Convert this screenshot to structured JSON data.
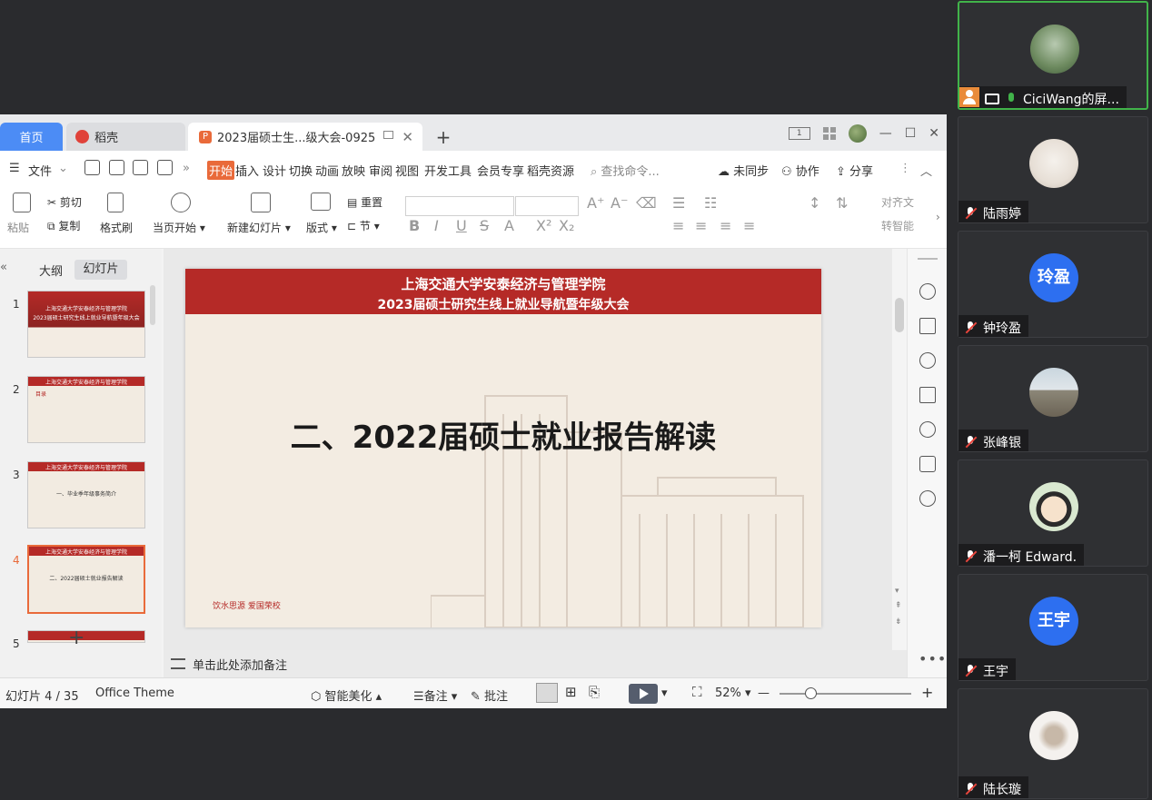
{
  "tabs": {
    "home": "首页",
    "docer": "稻壳",
    "document": "2023届硕士生...级大会-0925"
  },
  "window": {
    "view_badge": "1"
  },
  "menu": {
    "file": "文件",
    "items": [
      "开始",
      "插入",
      "设计",
      "切换",
      "动画",
      "放映",
      "审阅",
      "视图",
      "开发工具",
      "会员专享",
      "稻壳资源"
    ],
    "search_placeholder": "查找命令...",
    "sync": "未同步",
    "collab": "协作",
    "share": "分享"
  },
  "ribbon": {
    "paste": "粘贴",
    "cut": "剪切",
    "copy": "复制",
    "format_painter": "格式刷",
    "play_from_current": "当页开始",
    "new_slide": "新建幻灯片",
    "layout": "版式",
    "reset": "重置",
    "section": "节",
    "align_text": "对齐文",
    "convert_smartart": "转智能"
  },
  "left_panel": {
    "outline_tab": "大纲",
    "slides_tab": "幻灯片",
    "thumbnails": [
      {
        "num": "1",
        "line1": "上海交通大学安泰经济与管理学院",
        "line2": "2023届硕士研究生线上就业导航暨年级大会"
      },
      {
        "num": "2",
        "line1": "上海交通大学安泰经济与管理学院",
        "line2": "目录"
      },
      {
        "num": "3",
        "line1": "上海交通大学安泰经济与管理学院",
        "line2": "一、毕业季年级事务简介"
      },
      {
        "num": "4",
        "line1": "上海交通大学安泰经济与管理学院",
        "line2": "二、2022届硕士就业报告解读"
      },
      {
        "num": "5",
        "line1": "",
        "line2": ""
      }
    ]
  },
  "slide": {
    "header_line1": "上海交通大学安泰经济与管理学院",
    "header_line2": "2023届硕士研究生线上就业导航暨年级大会",
    "title": "二、2022届硕士就业报告解读",
    "footer": "饮水思源 爱国荣校"
  },
  "notes": {
    "placeholder": "单击此处添加备注"
  },
  "status": {
    "slide_counter": "幻灯片 4 / 35",
    "theme": "Office Theme",
    "beautify": "智能美化",
    "notes": "备注",
    "comments": "批注",
    "zoom": "52%"
  },
  "participants": [
    {
      "name": "CiciWang的屏...",
      "type": "photo",
      "sharing": true,
      "mic": "on"
    },
    {
      "name": "陆雨婷",
      "type": "photo",
      "mic": "off"
    },
    {
      "name": "钟玲盈",
      "type": "initials",
      "initials": "玲盈",
      "mic": "off"
    },
    {
      "name": "张峰银",
      "type": "photo",
      "mic": "off"
    },
    {
      "name": "潘一柯 Edward.",
      "type": "photo",
      "mic": "off"
    },
    {
      "name": "王宇",
      "type": "initials",
      "initials": "王宇",
      "mic": "off"
    },
    {
      "name": "陆长璇",
      "type": "photo",
      "mic": "off"
    }
  ],
  "colors": {
    "active_tile_border": "#41b34a",
    "slide_band": "#b52a27",
    "accent_orange": "#e96a3a",
    "initials_avatar": "#2d6ff0",
    "mic_muted": "#e8453c"
  }
}
